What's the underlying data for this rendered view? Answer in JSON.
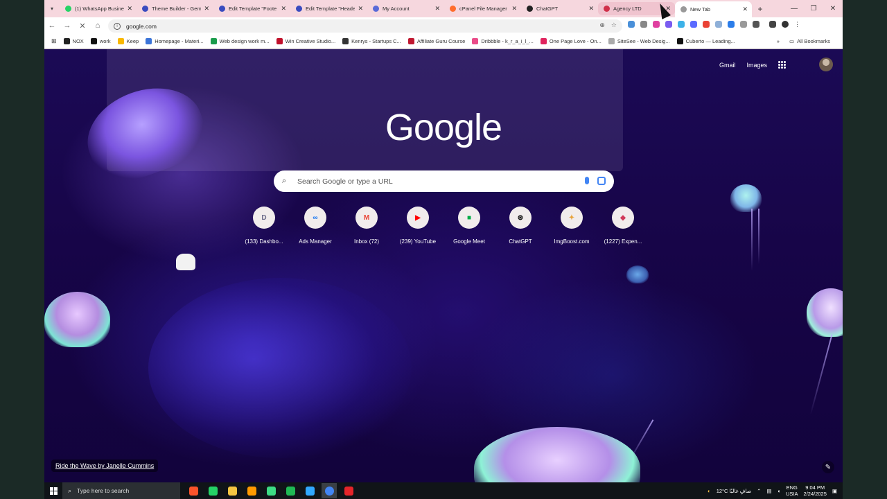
{
  "browser": {
    "tabs": [
      {
        "title": "(1) WhatsApp Busine",
        "icon": "whatsapp-icon",
        "color": "#25d366",
        "state": "normal"
      },
      {
        "title": "Theme Builder - Gem",
        "icon": "gem-icon",
        "color": "#3a4bbf",
        "state": "normal"
      },
      {
        "title": "Edit Template \"Foote",
        "icon": "gem-icon",
        "color": "#3a4bbf",
        "state": "normal"
      },
      {
        "title": "Edit Template \"Heade",
        "icon": "gem-icon",
        "color": "#3a4bbf",
        "state": "normal"
      },
      {
        "title": "My Account",
        "icon": "grid-icon",
        "color": "#5a6ad8",
        "state": "normal"
      },
      {
        "title": "cPanel File Manager",
        "icon": "cpanel-icon",
        "color": "#ff6c2c",
        "state": "normal"
      },
      {
        "title": "ChatGPT",
        "icon": "chatgpt-icon",
        "color": "#222222",
        "state": "normal"
      },
      {
        "title": "Agency LTD",
        "icon": "agency-icon",
        "color": "#d0304a",
        "state": "hover"
      },
      {
        "title": "New Tab",
        "icon": "newtab-icon",
        "color": "#999999",
        "state": "active"
      }
    ],
    "address": "google.com",
    "bookmarks": [
      {
        "label": "NOX",
        "color": "#222222"
      },
      {
        "label": "work",
        "color": "#111111"
      },
      {
        "label": "Keep",
        "color": "#f9b800"
      },
      {
        "label": "Homepage - Materi...",
        "color": "#3b74d8"
      },
      {
        "label": "Web design work m...",
        "color": "#1a9c4b"
      },
      {
        "label": "Win Creative Studio...",
        "color": "#c0102a"
      },
      {
        "label": "Kenrys - Startups C...",
        "color": "#333333"
      },
      {
        "label": "Affiliate Guru Course",
        "color": "#c01830"
      },
      {
        "label": "Dribbble - k_r_a_i_l_...",
        "color": "#ea4c89"
      },
      {
        "label": "One Page Love - On...",
        "color": "#e0245e"
      },
      {
        "label": "SiteSee - Web Desig...",
        "color": "#aaaaaa"
      },
      {
        "label": "Cuberto — Leading...",
        "color": "#111111"
      }
    ],
    "all_bookmarks": "All Bookmarks"
  },
  "ntp": {
    "gmail": "Gmail",
    "images": "Images",
    "logo": "Google",
    "search_placeholder": "Search Google or type a URL",
    "shortcuts": [
      {
        "label": "(133) Dashbo...",
        "glyph": "D",
        "color": "#6b6b8a"
      },
      {
        "label": "Ads Manager",
        "glyph": "∞",
        "color": "#1877f2"
      },
      {
        "label": "Inbox (72)",
        "glyph": "M",
        "color": "#ea4335"
      },
      {
        "label": "(239) YouTube",
        "glyph": "▶",
        "color": "#ff0000"
      },
      {
        "label": "Google Meet",
        "glyph": "■",
        "color": "#00ac47"
      },
      {
        "label": "ChatGPT",
        "glyph": "⊛",
        "color": "#111111"
      },
      {
        "label": "ImgBoost.com",
        "glyph": "✦",
        "color": "#e8a33c"
      },
      {
        "label": "(1227) Expen...",
        "glyph": "◆",
        "color": "#d03a5a"
      }
    ],
    "credit": "Ride the Wave by Janelle Cummins"
  },
  "taskbar": {
    "search_placeholder": "Type here to search",
    "weather": "12°C صافٍ غالبًا",
    "lang_top": "ENG",
    "lang_bottom": "USIA",
    "time": "9:04 PM",
    "date": "2/24/2025",
    "apps": [
      {
        "icon": "brave-icon",
        "color": "#fb542b"
      },
      {
        "icon": "whatsapp-icon",
        "color": "#25d366"
      },
      {
        "icon": "file-explorer-icon",
        "color": "#f4c542"
      },
      {
        "icon": "illustrator-icon",
        "color": "#ff9a00"
      },
      {
        "icon": "android-icon",
        "color": "#3ddc84"
      },
      {
        "icon": "camtasia-icon",
        "color": "#1fb954"
      },
      {
        "icon": "photoshop-icon",
        "color": "#31a8ff"
      },
      {
        "icon": "chrome-icon",
        "color": "#4285f4"
      },
      {
        "icon": "recorder-icon",
        "color": "#e5252a"
      }
    ]
  }
}
